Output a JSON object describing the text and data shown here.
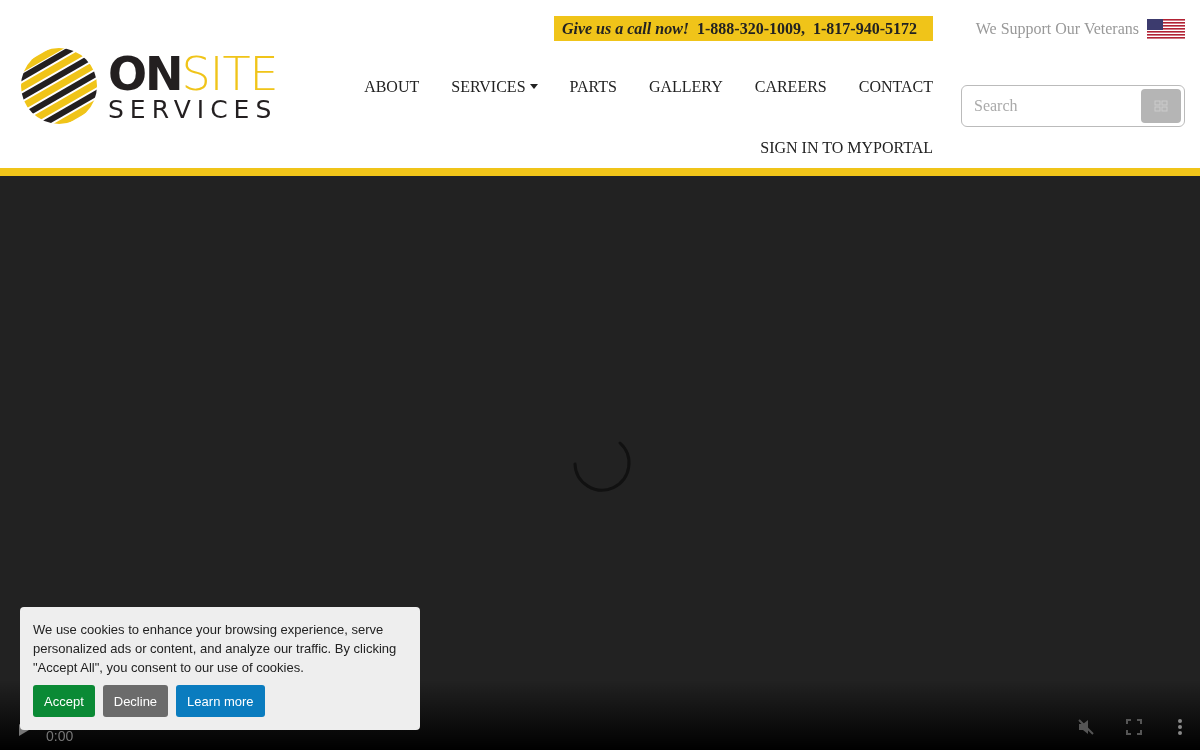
{
  "logo": {
    "word_1": "ON",
    "word_2": "SITE",
    "word_3": "SERVICES"
  },
  "call_bar": {
    "lead": "Give us a call now!",
    "phones": [
      "1-888-320-1009,",
      "1-817-940-5172"
    ]
  },
  "veterans": {
    "text": "We Support Our Veterans"
  },
  "nav": [
    {
      "label": "ABOUT",
      "dropdown": false
    },
    {
      "label": "SERVICES",
      "dropdown": true
    },
    {
      "label": "PARTS",
      "dropdown": false
    },
    {
      "label": "GALLERY",
      "dropdown": false
    },
    {
      "label": "CAREERS",
      "dropdown": false
    },
    {
      "label": "CONTACT",
      "dropdown": false
    }
  ],
  "portal_link": "SIGN IN TO MYPORTAL",
  "search": {
    "placeholder": "Search"
  },
  "video": {
    "time": "0:00",
    "muted": true,
    "loading": true
  },
  "cookie": {
    "text": "We use cookies to enhance your browsing experience, serve personalized ads or content, and analyze our traffic. By clicking \"Accept All\", you consent to our use of cookies.",
    "buttons": [
      {
        "label": "Accept",
        "kind": "accept"
      },
      {
        "label": "Decline",
        "kind": "decline"
      },
      {
        "label": "Learn more",
        "kind": "info"
      }
    ]
  }
}
